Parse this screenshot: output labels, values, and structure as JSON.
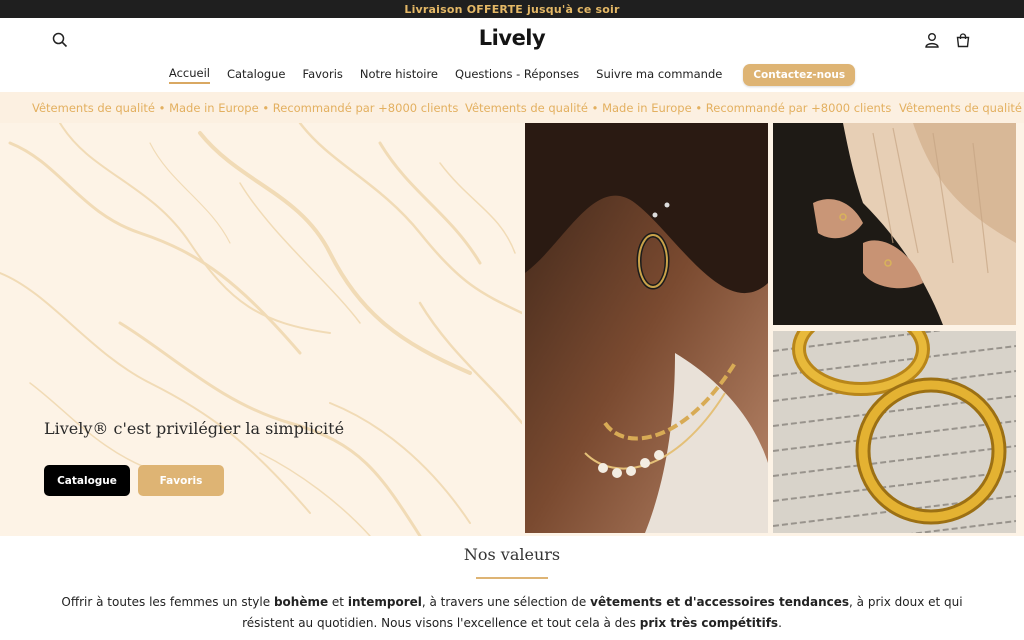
{
  "announcement": {
    "text": "Livraison OFFERTE jusqu'à ce soir"
  },
  "header": {
    "logo": "Lively",
    "search_icon": "search-icon",
    "account_icon": "user-icon",
    "cart_icon": "bag-icon"
  },
  "nav": {
    "items": [
      {
        "label": "Accueil",
        "active": true
      },
      {
        "label": "Catalogue"
      },
      {
        "label": "Favoris"
      },
      {
        "label": "Notre histoire"
      },
      {
        "label": "Questions - Réponses"
      },
      {
        "label": "Suivre ma commande"
      }
    ],
    "contact_label": "Contactez-nous"
  },
  "ticker": {
    "text": "Vêtements de qualité • Made in Europe • Recommandé par +8000 clients",
    "text_partial": "Vêtements de qualité •"
  },
  "hero": {
    "title": "Lively® c'est privilégier la simplicité",
    "btn_primary": "Catalogue",
    "btn_secondary": "Favoris"
  },
  "values": {
    "title": "Nos valeurs",
    "p1": "Offrir à toutes les femmes un style ",
    "b1": "bohème",
    "p2": " et ",
    "b2": "intemporel",
    "p3": ", à travers une sélection de ",
    "b3": "vêtements et d'accessoires tendances",
    "p4": ", à prix doux et qui résistent au quotidien. Nous visons l'excellence et tout cela à des ",
    "b4": "prix très compétitifs",
    "p5": "."
  },
  "colors": {
    "accent": "#deb474",
    "announcement_bg": "#1f1f1f",
    "ticker_bg": "#fcf0e1",
    "hero_bg": "#fdf3e6"
  }
}
